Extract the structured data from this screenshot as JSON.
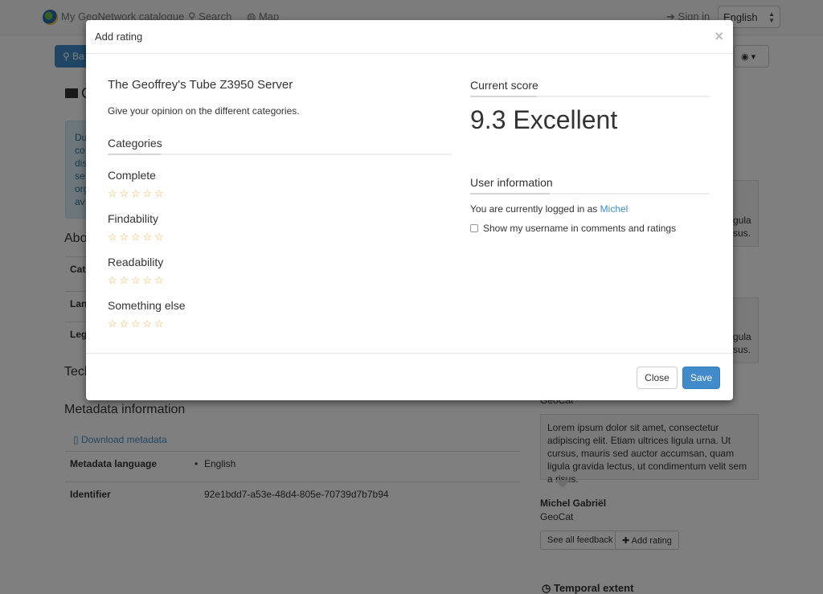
{
  "navbar": {
    "catalogue": "My GeoNetwork catalogue",
    "search": "Search",
    "map": "Map",
    "sign_in": "Sign in",
    "language": "English"
  },
  "background": {
    "search_btn": "Ba",
    "title_fragment": "C",
    "info_fragment": [
      "Du",
      "co",
      "dis",
      "se",
      "org",
      "av"
    ],
    "about_heading": "Abo",
    "rows": [
      {
        "label": "Cat"
      },
      {
        "label": "Lan"
      },
      {
        "label": "Leg"
      }
    ],
    "tech_heading": "Tech",
    "metadata_heading": "Metadata information",
    "download_link": "Download metadata",
    "metadata_language_label": "Metadata language",
    "metadata_language_value": "English",
    "identifier_label": "Identifier",
    "identifier_value": "92e1bdd7-a53e-48d4-805e-70739d7b7b94",
    "comment_fragments_1": [
      "gula",
      "sus."
    ],
    "comment_fragments_2": [
      "gula",
      "sus."
    ],
    "geocat_fragment": "GeoCat",
    "comment_text": "Lorem ipsum dolor sit amet, consectetur adipiscing elit. Etiam ultrices ligula urna. Ut cursus, mauris sed auctor accumsan, quam ligula gravida lectus, ut condimentum velit sem a risus.",
    "commenter_name": "Michel Gabriël",
    "commenter_org": "GeoCat",
    "see_all_feedback": "See all feedback",
    "add_rating": "Add rating",
    "temporal_extent": "Temporal extent"
  },
  "modal": {
    "title": "Add rating",
    "close_symbol": "×",
    "resource_title": "The Geoffrey's Tube Z3950 Server",
    "subtitle": "Give your opinion on the different categories.",
    "categories_heading": "Categories",
    "categories": [
      {
        "name": "Complete",
        "rating": 0
      },
      {
        "name": "Findability",
        "rating": 0
      },
      {
        "name": "Readability",
        "rating": 0
      },
      {
        "name": "Something else",
        "rating": 0
      }
    ],
    "current_score_heading": "Current score",
    "score": "9.3 Excellent",
    "user_info_heading": "User information",
    "logged_in_text": "You are currently logged in as",
    "username": "Michel",
    "show_username_label": "Show my username in comments and ratings",
    "show_username_checked": false,
    "close_button": "Close",
    "save_button": "Save"
  },
  "colors": {
    "star": "#f0ad4e",
    "primary": "#428bca",
    "overlay": "rgba(0,0,0,0.5)"
  }
}
